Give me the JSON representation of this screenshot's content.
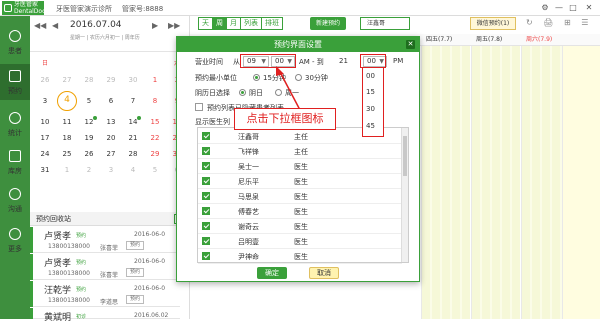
{
  "titlebar": {
    "logo_line1": "牙医管家",
    "logo_line2": "DentalDoc",
    "clinic": "牙医管家演示诊所",
    "account": "管家号:8888",
    "controls": [
      "⚙",
      "—",
      "□",
      "✕"
    ]
  },
  "leftnav": {
    "items": [
      {
        "label": "患者",
        "icon": "user-icon"
      },
      {
        "label": "预约",
        "icon": "calendar-icon"
      },
      {
        "label": "统计",
        "icon": "chart-icon"
      },
      {
        "label": "库房",
        "icon": "warehouse-icon"
      },
      {
        "label": "沟通",
        "icon": "play-icon"
      },
      {
        "label": "更多",
        "icon": "grid-icon"
      }
    ]
  },
  "calendar": {
    "prev": "◀",
    "prev_year": "◀◀",
    "date": "2016.07.04",
    "next": "▶",
    "next_year": "▶▶",
    "subtitle": "星期一 | 农历六月初一 | 周年历",
    "weeks": [
      [
        "",
        "",
        "",
        "",
        "",
        "",
        ""
      ],
      [
        "26",
        "27",
        "28",
        "29",
        "30",
        "1",
        "2"
      ],
      [
        "3",
        "4",
        "5",
        "6",
        "7",
        "8",
        "9"
      ],
      [
        "10",
        "11",
        "12",
        "13",
        "14",
        "15",
        "16"
      ],
      [
        "17",
        "18",
        "19",
        "20",
        "21",
        "22",
        "23"
      ],
      [
        "24",
        "25",
        "26",
        "27",
        "28",
        "29",
        "30"
      ],
      [
        "31",
        "1",
        "2",
        "3",
        "4",
        "5",
        "6"
      ]
    ],
    "today": "4"
  },
  "appt_list": {
    "title": "预约回收站",
    "button": "病",
    "items": [
      {
        "name": "卢贤孝",
        "tag": "预约",
        "date": "2016-06-0",
        "phone": "13800138000",
        "doctor": "张喜菲",
        "select": "预约"
      },
      {
        "name": "卢贤孝",
        "tag": "预约",
        "date": "2016-06-0",
        "phone": "13800138000",
        "doctor": "张喜菲",
        "select": "预约"
      },
      {
        "name": "汪乾学",
        "tag": "预约",
        "date": "2016-06-0",
        "phone": "13800138000",
        "doctor": "李道思",
        "select": "预约"
      },
      {
        "name": "黄斌明",
        "tag": "初诊",
        "date": "2016.06.02",
        "phone": "",
        "doctor": "",
        "select": ""
      }
    ]
  },
  "main": {
    "view_tabs": [
      "天",
      "周",
      "月",
      "列表",
      "排班"
    ],
    "active_tab": "周",
    "new_button": "新建预约",
    "doctor_select": "汪鑫哥",
    "wechat_button": "微信预约(1)",
    "toolbar_icons": [
      "↻",
      "🖨",
      "⊞",
      "☰"
    ],
    "col_heads": [
      "四五(7.7)",
      "周五(7.8)",
      "周六(7.9)"
    ]
  },
  "dialog": {
    "title": "预约界面设置",
    "close": "✕",
    "business_time_label": "营业时间",
    "from_label": "从",
    "from_hour": "09",
    "from_min": "00",
    "am_to_label": "AM - 到",
    "to_hour": "21",
    "to_min": "00",
    "pm_label": "PM",
    "min_unit_label": "预约最小单位",
    "unit_15": "15分钟",
    "unit_30": "30分钟",
    "week_start_label": "阴历日选择",
    "week_day": "阴日",
    "week_monday": "周一",
    "show_hidden_label": "预约列表已隐藏患者列表",
    "doctor_list_label": "显示医生列",
    "doctors": [
      {
        "name": "汪鑫哥",
        "title": "主任",
        "checked": true
      },
      {
        "name": "飞祥锋",
        "title": "主任",
        "checked": true
      },
      {
        "name": "吴士一",
        "title": "医生",
        "checked": true
      },
      {
        "name": "尼乐平",
        "title": "医生",
        "checked": true
      },
      {
        "name": "马思泉",
        "title": "医生",
        "checked": true
      },
      {
        "name": "傅春艺",
        "title": "医生",
        "checked": true
      },
      {
        "name": "谢奇云",
        "title": "医生",
        "checked": true
      },
      {
        "name": "吕明壹",
        "title": "医生",
        "checked": true
      },
      {
        "name": "尹神命",
        "title": "医生",
        "checked": true
      }
    ],
    "ok": "确定",
    "cancel": "取消",
    "dropdown_options": [
      "00",
      "15",
      "30",
      "45"
    ]
  },
  "annotation": {
    "callout": "点击下拉框图标"
  }
}
